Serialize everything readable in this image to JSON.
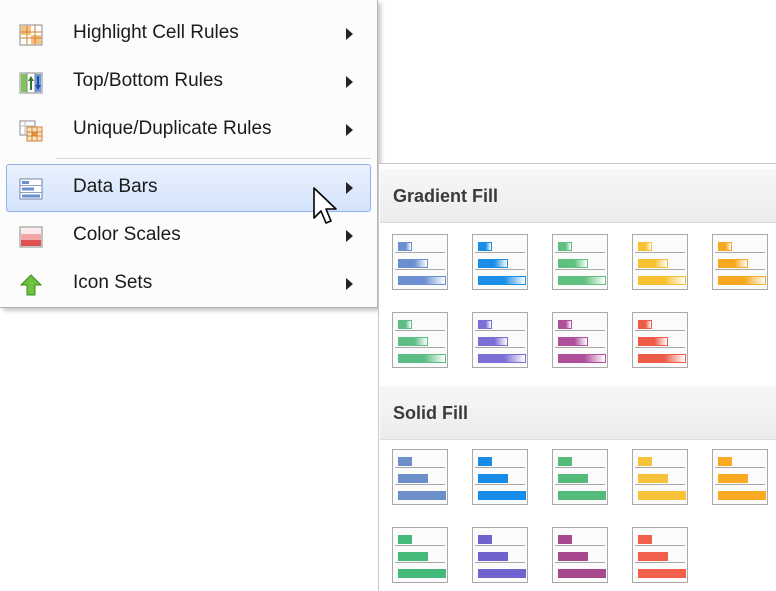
{
  "menu": {
    "items": [
      {
        "label": "Highlight Cell Rules",
        "icon": "highlight-cell-rules-icon"
      },
      {
        "label": "Top/Bottom Rules",
        "icon": "top-bottom-rules-icon"
      },
      {
        "label": "Unique/Duplicate Rules",
        "icon": "unique-duplicate-rules-icon"
      },
      {
        "label": "Data Bars",
        "icon": "data-bars-icon",
        "active": true
      },
      {
        "label": "Color Scales",
        "icon": "color-scales-icon"
      },
      {
        "label": "Icon Sets",
        "icon": "icon-sets-icon"
      }
    ]
  },
  "gallery": {
    "gradient": {
      "title": "Gradient Fill",
      "colors": [
        "#6b8fd0",
        "#1a8ee6",
        "#5fbf7f",
        "#f6c030",
        "#f8a820",
        "#5cbe86",
        "#7b6ed4",
        "#b04f9a",
        "#ee5c48"
      ]
    },
    "solid": {
      "title": "Solid Fill",
      "colors": [
        "#6d8fc9",
        "#168ce8",
        "#55bb7b",
        "#f6c23a",
        "#f9a922",
        "#45b97a",
        "#7163cf",
        "#a8488f",
        "#f0604a"
      ]
    }
  },
  "colors": {
    "menu_hover_bg": "#dde9fc",
    "menu_hover_border": "#8eb3ea",
    "section_header_bg": "#f0f0f0"
  }
}
